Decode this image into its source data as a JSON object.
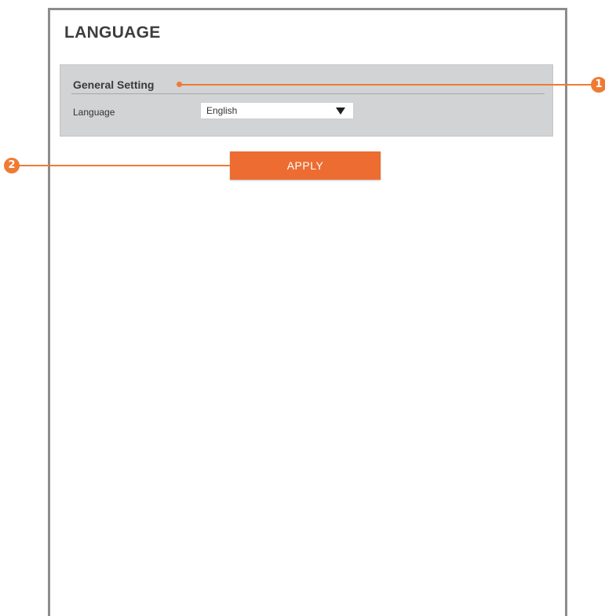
{
  "page": {
    "title": "LANGUAGE"
  },
  "general_setting": {
    "title": "General Setting",
    "language_label": "Language",
    "language_value": "English"
  },
  "actions": {
    "apply_label": "APPLY"
  },
  "callouts": [
    {
      "number": "1",
      "target": "General Setting section"
    },
    {
      "number": "2",
      "target": "APPLY button"
    }
  ],
  "colors": {
    "accent": "#ec6c32",
    "panel_bg": "#d2d3d4",
    "frame_border": "#8c8c8c",
    "title_text": "#3d3d3d"
  }
}
